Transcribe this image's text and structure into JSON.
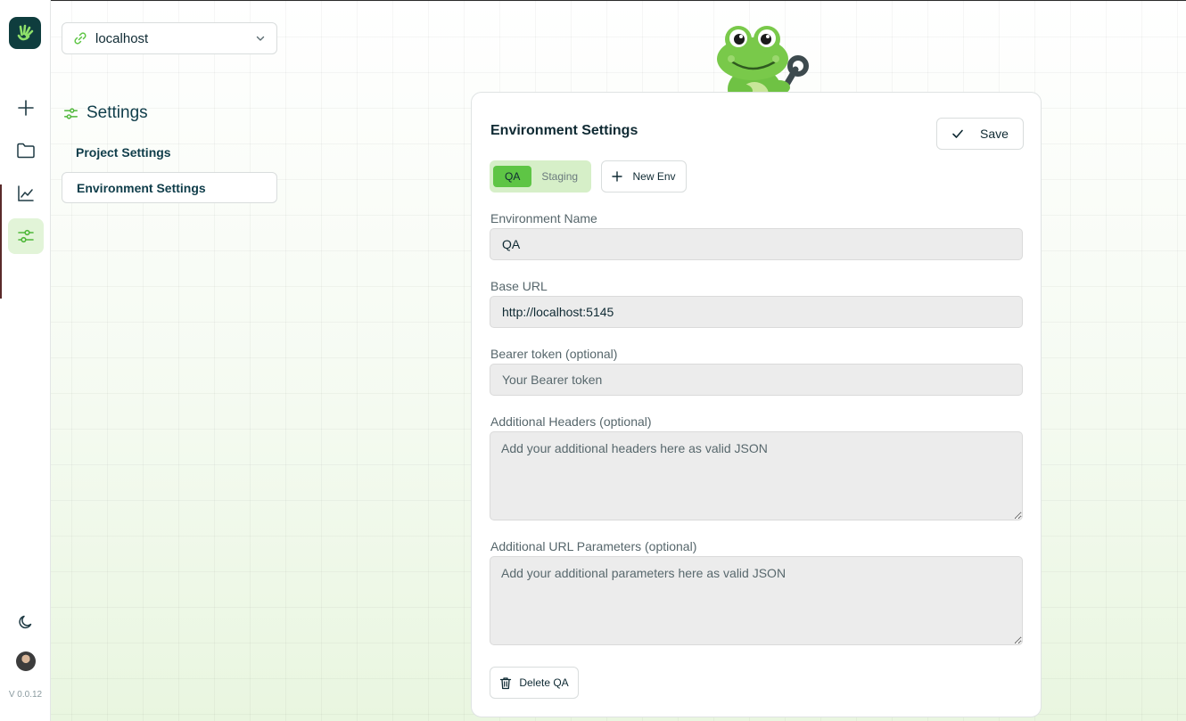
{
  "rail": {
    "logo_icon": "frog-hand-logo-icon",
    "items": [
      {
        "icon": "plus-icon",
        "active": false
      },
      {
        "icon": "folder-icon",
        "active": false
      },
      {
        "icon": "chart-line-icon",
        "active": false
      },
      {
        "icon": "settings-sliders-icon",
        "active": true
      }
    ],
    "theme_icon": "moon-icon",
    "version": "V 0.0.12"
  },
  "project_selector": {
    "value": "localhost",
    "icon": "link-icon"
  },
  "settings_nav": {
    "title": "Settings",
    "items": [
      {
        "label": "Project Settings",
        "active": false
      },
      {
        "label": "Environment Settings",
        "active": true
      }
    ]
  },
  "env_settings": {
    "title": "Environment Settings",
    "save_label": "Save",
    "tabs": [
      {
        "label": "QA",
        "active": true
      },
      {
        "label": "Staging",
        "active": false
      }
    ],
    "new_env_label": "New Env",
    "fields": {
      "name_label": "Environment Name",
      "name_value": "QA",
      "base_url_label": "Base URL",
      "base_url_value": "http://localhost:5145",
      "bearer_label": "Bearer token (optional)",
      "bearer_placeholder": "Your Bearer token",
      "headers_label": "Additional Headers (optional)",
      "headers_placeholder": "Add your additional headers here as valid JSON",
      "params_label": "Additional URL Parameters (optional)",
      "params_placeholder": "Add your additional parameters here as valid JSON"
    },
    "delete_label": "Delete QA"
  },
  "colors": {
    "accent": "#5ec545",
    "accent_soft": "#d6efc8",
    "brand_dark": "#0f3d3e"
  }
}
